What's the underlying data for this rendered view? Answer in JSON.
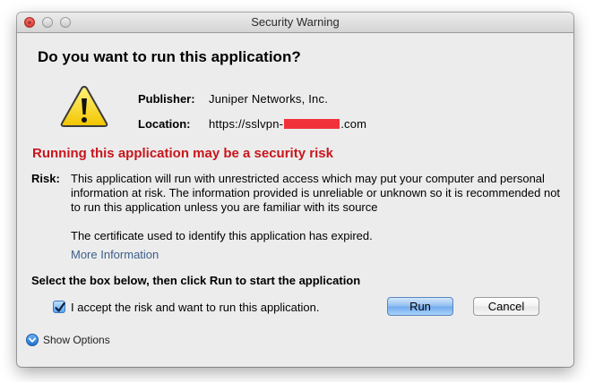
{
  "window": {
    "title": "Security Warning"
  },
  "dialog": {
    "heading": "Do you want to run this application?",
    "publisher_label": "Publisher:",
    "publisher_value": "Juniper Networks, Inc.",
    "location_label": "Location:",
    "location_prefix": "https://sslvpn-",
    "location_suffix": ".com",
    "risk_header": "Running this application may be a security risk",
    "risk_label": "Risk:",
    "risk_text": "This application will run with unrestricted access which may put your computer and personal information at risk. The information provided is unreliable or unknown so it is recommended not to run this application unless you are familiar with its source",
    "cert_text": "The certificate used to identify this application has expired.",
    "more_info": "More Information",
    "select_instruction": "Select the box below, then click Run to start the application",
    "accept_label": "I accept the risk and want to run this application.",
    "accept_checked": true,
    "run_button": "Run",
    "cancel_button": "Cancel",
    "show_options": "Show Options"
  },
  "icons": {
    "warning": "warning-triangle-icon",
    "checkmark": "checkmark-icon",
    "disclosure": "chevron-down-icon"
  },
  "colors": {
    "risk_red": "#c8161c",
    "link_blue": "#3d5f8c",
    "redaction": "#f2323a",
    "default_button_blue": "#72aaee"
  }
}
